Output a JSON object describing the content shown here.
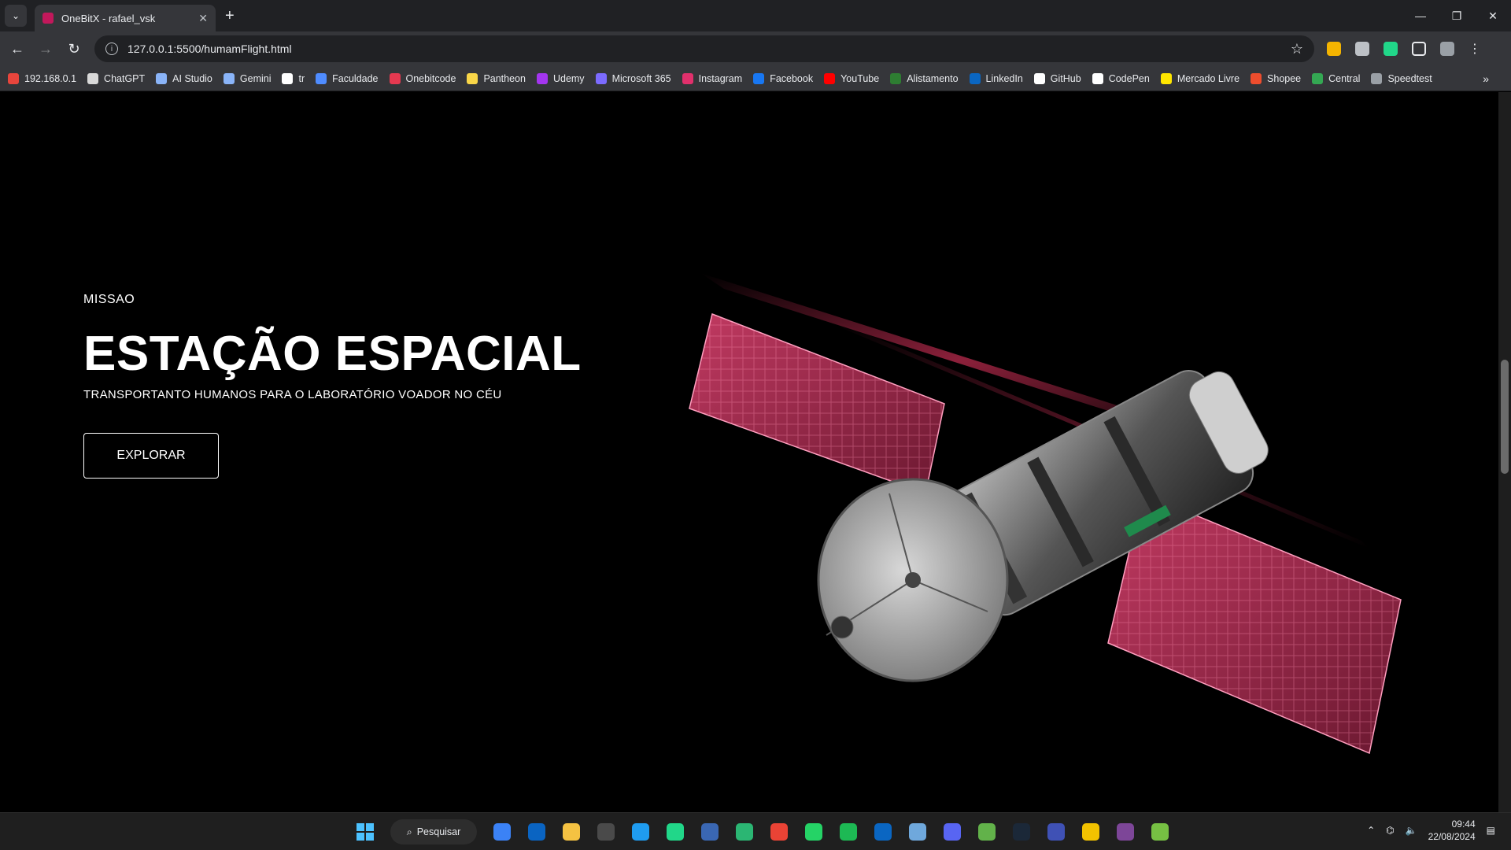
{
  "browser": {
    "tab_title": "OneBitX - rafael_vsk",
    "url": "127.0.0.1:5500/humamFlight.html",
    "bookmarks": [
      {
        "label": "192.168.0.1",
        "color": "#e8453c"
      },
      {
        "label": "ChatGPT",
        "color": "#d9d9d9"
      },
      {
        "label": "AI Studio",
        "color": "#8ab4f8"
      },
      {
        "label": "Gemini",
        "color": "#8ab4f8"
      },
      {
        "label": "tr",
        "color": "#ffffff"
      },
      {
        "label": "Faculdade",
        "color": "#4f8cff"
      },
      {
        "label": "Onebitcode",
        "color": "#e53950"
      },
      {
        "label": "Pantheon",
        "color": "#f9d648"
      },
      {
        "label": "Udemy",
        "color": "#a435f0"
      },
      {
        "label": "Microsoft 365",
        "color": "#7c6bff"
      },
      {
        "label": "Instagram",
        "color": "#e1306c"
      },
      {
        "label": "Facebook",
        "color": "#1877f2"
      },
      {
        "label": "YouTube",
        "color": "#ff0000"
      },
      {
        "label": "Alistamento",
        "color": "#2e7d32"
      },
      {
        "label": "LinkedIn",
        "color": "#0a66c2"
      },
      {
        "label": "GitHub",
        "color": "#ffffff"
      },
      {
        "label": "CodePen",
        "color": "#ffffff"
      },
      {
        "label": "Mercado Livre",
        "color": "#ffe600"
      },
      {
        "label": "Shopee",
        "color": "#ee4d2d"
      },
      {
        "label": "Central",
        "color": "#34a853"
      },
      {
        "label": "Speedtest",
        "color": "#9aa0a6"
      }
    ]
  },
  "hero": {
    "kicker": "MISSAO",
    "headline": "ESTAÇÃO ESPACIAL",
    "subtitle": "TRANSPORTANTO HUMANOS PARA O LABORATÓRIO VOADOR NO CÉU",
    "cta_label": "EXPLORAR"
  },
  "taskbar": {
    "search_label": "Pesquisar",
    "time": "09:44",
    "date": "22/08/2024",
    "apps": [
      {
        "name": "store-icon",
        "color": "#3b82f6"
      },
      {
        "name": "outlook-icon",
        "color": "#0a64c2"
      },
      {
        "name": "file-explorer-icon",
        "color": "#f5c242"
      },
      {
        "name": "terminal-icon",
        "color": "#4a4a4a"
      },
      {
        "name": "vscode-icon",
        "color": "#1f9cf0"
      },
      {
        "name": "pycharm-icon",
        "color": "#21d789"
      },
      {
        "name": "ssms-icon",
        "color": "#3a67b3"
      },
      {
        "name": "edge-icon",
        "color": "#2bb673"
      },
      {
        "name": "chrome-icon",
        "color": "#ea4335"
      },
      {
        "name": "whatsapp-icon",
        "color": "#25d366"
      },
      {
        "name": "spotify-icon",
        "color": "#1db954"
      },
      {
        "name": "linkedin-icon",
        "color": "#0a66c2"
      },
      {
        "name": "notepad-icon",
        "color": "#6fa8dc"
      },
      {
        "name": "discord-icon",
        "color": "#5865f2"
      },
      {
        "name": "minecraft-icon",
        "color": "#62b24a"
      },
      {
        "name": "steam-icon",
        "color": "#1b2838"
      },
      {
        "name": "app-icon",
        "color": "#3f51b5"
      },
      {
        "name": "game-icon",
        "color": "#f2c200"
      },
      {
        "name": "tor-icon",
        "color": "#7d4698"
      },
      {
        "name": "utorrent-icon",
        "color": "#76c043"
      }
    ]
  }
}
